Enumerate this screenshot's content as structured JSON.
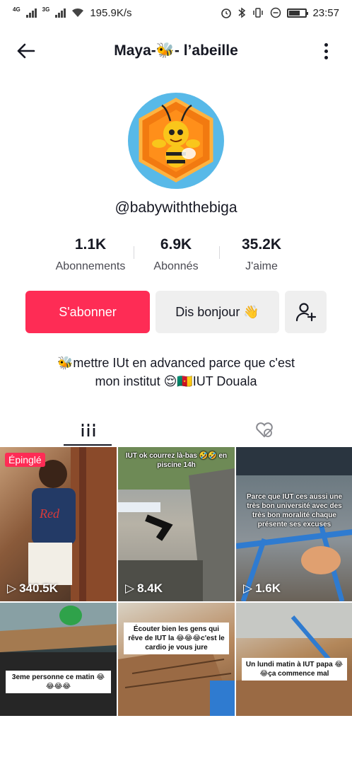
{
  "status_bar": {
    "net1": "4G",
    "net2": "3G",
    "speed": "195.9K/s",
    "time": "23:57"
  },
  "header": {
    "title": "Maya-🐝- l’abeille"
  },
  "profile": {
    "username": "@babywiththebiga",
    "bio_line1": "🐝mettre IUt en advanced parce que c'est",
    "bio_line2": "mon institut 😌🇨🇲IUT Douala"
  },
  "stats": [
    {
      "value": "1.1K",
      "label": "Abonnements"
    },
    {
      "value": "6.9K",
      "label": "Abonnés"
    },
    {
      "value": "35.2K",
      "label": "J'aime"
    }
  ],
  "buttons": {
    "follow": "S'abonner",
    "hello": "Dis bonjour 👋"
  },
  "videos": [
    {
      "views": "340.5K",
      "badge": "Épinglé",
      "caption": ""
    },
    {
      "views": "8.4K",
      "caption": "IUT ok courrez là-bas 🤣🤣 en piscine 14h"
    },
    {
      "views": "1.6K",
      "caption": "Parce que IUT ces aussi une très bon université avec des très bon moralité chaque présente ses excuses"
    },
    {
      "views": "",
      "caption": "3eme personne ce matin 😂 😂😂😂"
    },
    {
      "views": "",
      "caption": "Écouter bien les gens qui rêve de IUT la 😂😂😂c'est le cardio je vous jure"
    },
    {
      "views": "",
      "caption": "Un lundi matin à IUT papa 😂 😂ça commence mal"
    }
  ],
  "colors": {
    "accent": "#fe2c55",
    "secondary_button": "#efefef",
    "text": "#161823"
  },
  "icons": {
    "back": "arrow-left-icon",
    "more": "vertical-dots-icon",
    "videos_tab": "grid-icon",
    "liked_tab": "liked-hidden-icon",
    "add_user": "add-user-icon",
    "play": "play-icon"
  }
}
